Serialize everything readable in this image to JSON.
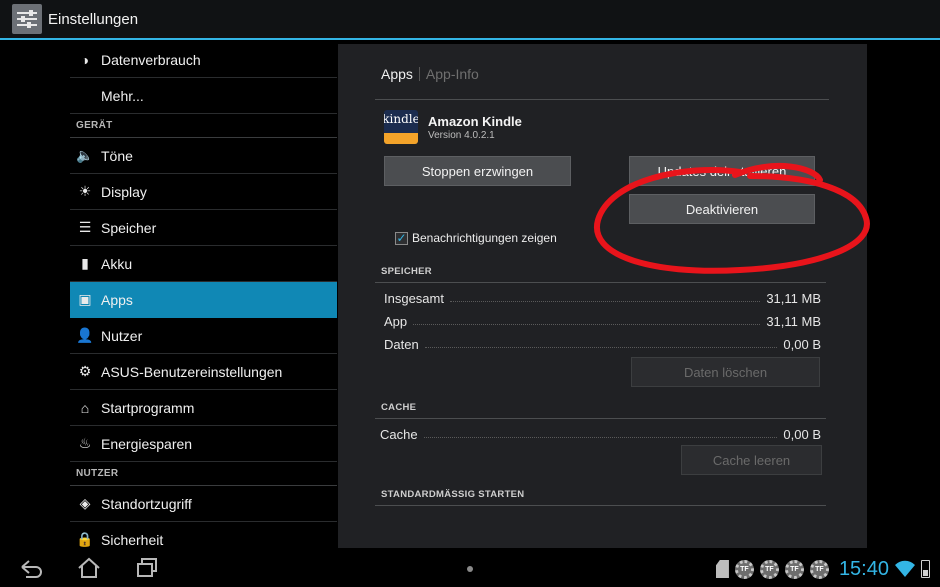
{
  "actionbar": {
    "title": "Einstellungen"
  },
  "sidebar": {
    "items": [
      {
        "type": "item",
        "label": "Datenverbrauch",
        "icon": "data-usage-icon",
        "glyph": "◑"
      },
      {
        "type": "item",
        "label": "Mehr...",
        "icon": "",
        "glyph": ""
      },
      {
        "type": "section",
        "label": "GERÄT"
      },
      {
        "type": "item",
        "label": "Töne",
        "icon": "speaker-icon",
        "glyph": "🔈"
      },
      {
        "type": "item",
        "label": "Display",
        "icon": "display-icon",
        "glyph": "☀"
      },
      {
        "type": "item",
        "label": "Speicher",
        "icon": "storage-icon",
        "glyph": "☰"
      },
      {
        "type": "item",
        "label": "Akku",
        "icon": "battery-icon",
        "glyph": "▮"
      },
      {
        "type": "item",
        "label": "Apps",
        "icon": "apps-icon",
        "glyph": "▣",
        "active": true
      },
      {
        "type": "item",
        "label": "Nutzer",
        "icon": "user-icon",
        "glyph": "👤"
      },
      {
        "type": "item",
        "label": "ASUS-Benutzereinstellungen",
        "icon": "gear-icon",
        "glyph": "⚙"
      },
      {
        "type": "item",
        "label": "Startprogramm",
        "icon": "home-icon",
        "glyph": "⌂"
      },
      {
        "type": "item",
        "label": "Energiesparen",
        "icon": "leaf-icon",
        "glyph": "♨"
      },
      {
        "type": "section",
        "label": "NUTZER"
      },
      {
        "type": "item",
        "label": "Standortzugriff",
        "icon": "location-icon",
        "glyph": "◈"
      },
      {
        "type": "item",
        "label": "Sicherheit",
        "icon": "lock-icon",
        "glyph": "🔒"
      }
    ]
  },
  "detail": {
    "breadcrumb": {
      "current": "Apps",
      "next": "App-Info"
    },
    "app": {
      "name": "Amazon Kindle",
      "version": "Version 4.0.2.1",
      "icon_text": "kindle"
    },
    "buttons": {
      "force_stop": "Stoppen erzwingen",
      "uninstall_updates": "Updates deinstallieren",
      "disable": "Deaktivieren"
    },
    "notifications": {
      "label": "Benachrichtigungen zeigen",
      "checked": true
    },
    "storage": {
      "header": "SPEICHER",
      "rows": [
        {
          "label": "Insgesamt",
          "value": "31,11 MB"
        },
        {
          "label": "App",
          "value": "31,11 MB"
        },
        {
          "label": "Daten",
          "value": "0,00 B"
        }
      ],
      "clear_data": "Daten löschen"
    },
    "cache": {
      "header": "CACHE",
      "row": {
        "label": "Cache",
        "value": "0,00 B"
      },
      "clear_cache": "Cache leeren"
    },
    "launch_default": {
      "header": "STANDARDMÄSSIG STARTEN"
    }
  },
  "statusbar": {
    "time": "15:40",
    "notification_badges": [
      "TF",
      "TF",
      "TF",
      "TF"
    ]
  },
  "colors": {
    "accent": "#33b5e5",
    "active_item": "#1088b5",
    "annotation": "#e8141b"
  }
}
